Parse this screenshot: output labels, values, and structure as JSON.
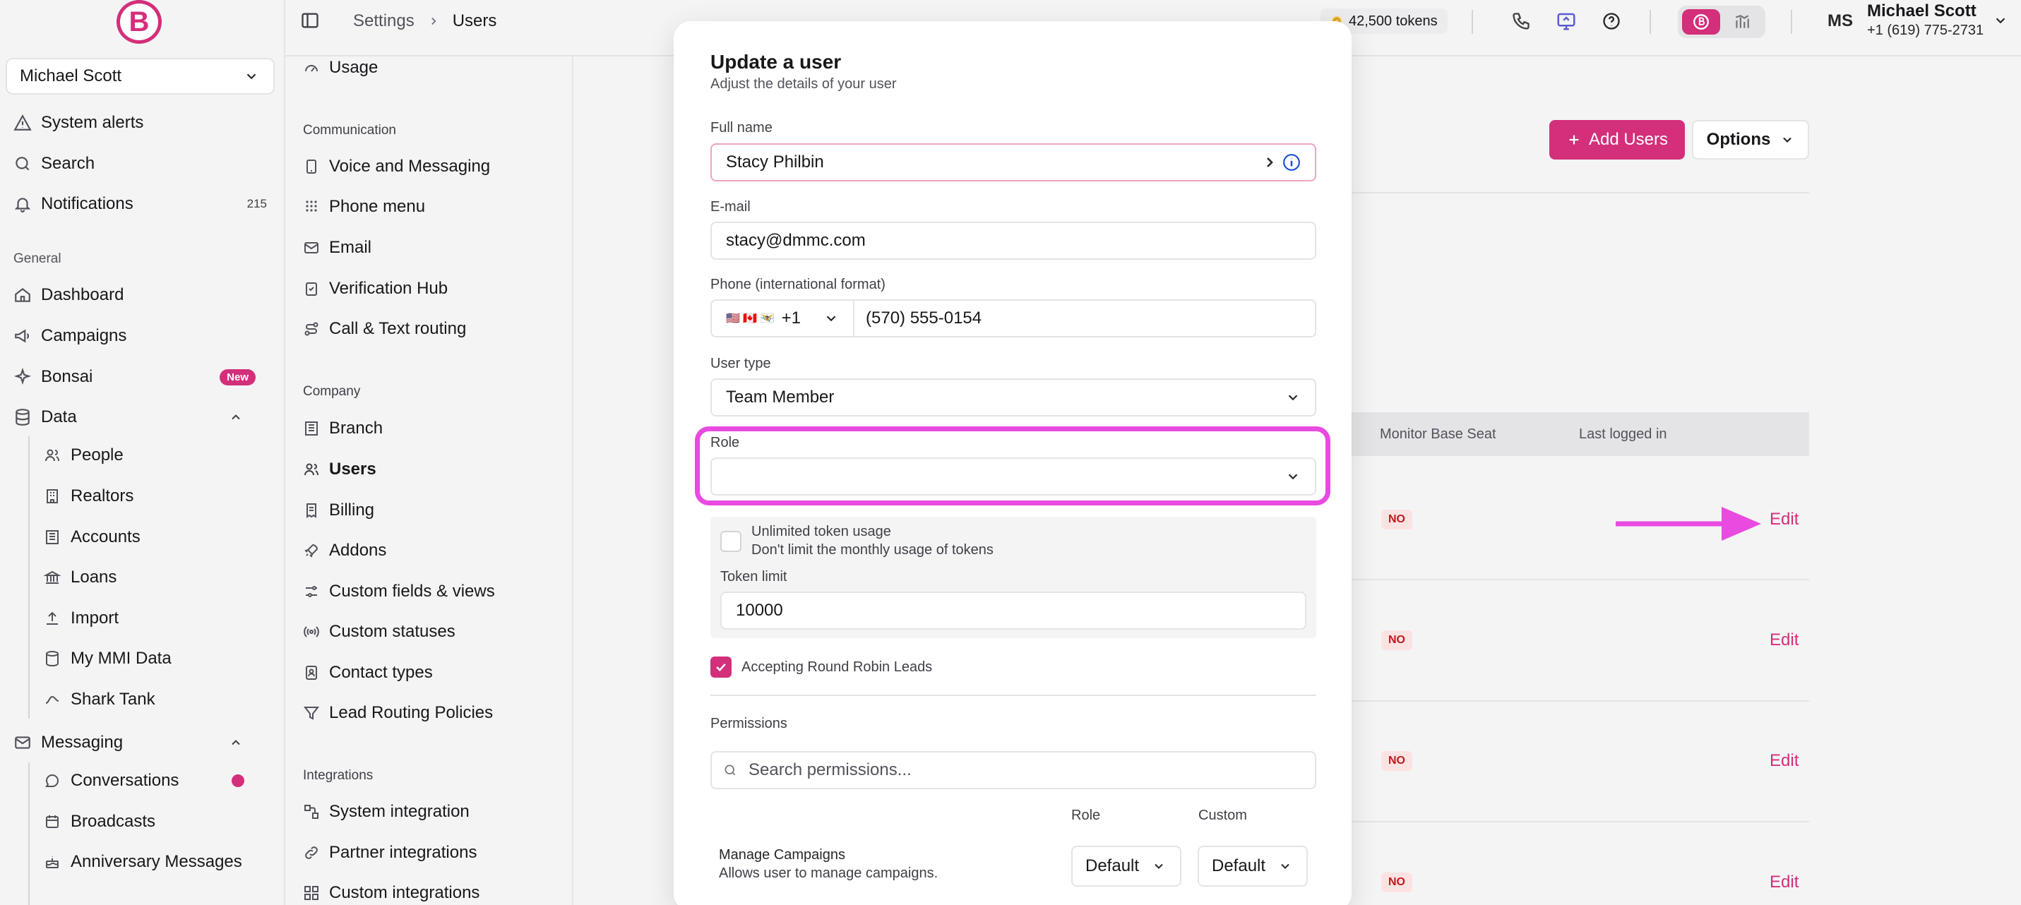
{
  "sidebar": {
    "logo_letter": "B",
    "user_select": "Michael Scott",
    "items_top": [
      {
        "label": "System alerts"
      },
      {
        "label": "Search"
      },
      {
        "label": "Notifications",
        "badge": "215"
      }
    ],
    "general_title": "General",
    "general_items": [
      {
        "label": "Dashboard"
      },
      {
        "label": "Campaigns"
      },
      {
        "label": "Bonsai",
        "badge": "New"
      },
      {
        "label": "Data"
      }
    ],
    "data_items": [
      {
        "label": "People"
      },
      {
        "label": "Realtors"
      },
      {
        "label": "Accounts"
      },
      {
        "label": "Loans"
      },
      {
        "label": "Import"
      },
      {
        "label": "My MMI Data"
      },
      {
        "label": "Shark Tank"
      }
    ],
    "messaging": {
      "label": "Messaging"
    },
    "messaging_items": [
      {
        "label": "Conversations"
      },
      {
        "label": "Broadcasts"
      },
      {
        "label": "Anniversary Messages"
      }
    ]
  },
  "settings_nav": {
    "top_item": "Usage",
    "communication_title": "Communication",
    "communication_items": [
      "Voice and Messaging",
      "Phone menu",
      "Email",
      "Verification Hub",
      "Call & Text routing"
    ],
    "company_title": "Company",
    "company_items": [
      "Branch",
      "Users",
      "Billing",
      "Addons",
      "Custom fields & views",
      "Custom statuses",
      "Contact types",
      "Lead Routing Policies"
    ],
    "integrations_title": "Integrations",
    "integrations_items": [
      "System integration",
      "Partner integrations",
      "Custom integrations"
    ]
  },
  "topbar": {
    "breadcrumb": [
      "Settings",
      "Users"
    ],
    "tokens": "42,500 tokens",
    "avatar_initials": "MS",
    "account_name": "Michael Scott",
    "account_phone": "+1 (619) 775-2731"
  },
  "page": {
    "add_users_label": "Add Users",
    "options_label": "Options",
    "table_headers": [
      "Monitor Base Seat",
      "Last logged in"
    ],
    "rows": [
      {
        "monitor": "NO",
        "action": "Edit"
      },
      {
        "monitor": "NO",
        "action": "Edit"
      },
      {
        "monitor": "NO",
        "action": "Edit"
      },
      {
        "monitor": "NO",
        "action": "Edit"
      }
    ]
  },
  "modal": {
    "title": "Update a user",
    "subtitle": "Adjust the details of your user",
    "full_name_label": "Full name",
    "full_name_value": "Stacy Philbin",
    "email_label": "E-mail",
    "email_value": "stacy@dmmc.com",
    "phone_label": "Phone (international format)",
    "phone_flags": "🇺🇸 🇨🇦 🇻🇮",
    "phone_code": "+1",
    "phone_value": "(570) 555-0154",
    "user_type_label": "User type",
    "user_type_value": "Team Member",
    "role_label": "Role",
    "role_value": "",
    "unlimited_label": "Unlimited token usage",
    "unlimited_desc": "Don't limit the monthly usage of tokens",
    "unlimited_checked": false,
    "token_limit_label": "Token limit",
    "token_limit_value": "10000",
    "round_robin_label": "Accepting Round Robin Leads",
    "round_robin_checked": true,
    "permissions_label": "Permissions",
    "permissions_search_placeholder": "Search permissions...",
    "perm_col_role": "Role",
    "perm_col_custom": "Custom",
    "perm_row_title": "Manage Campaigns",
    "perm_row_desc": "Allows user to manage campaigns.",
    "perm_row_role": "Default",
    "perm_row_custom": "Default"
  },
  "colors": {
    "brand": "#d32f7a",
    "highlight": "#e94ae0"
  }
}
